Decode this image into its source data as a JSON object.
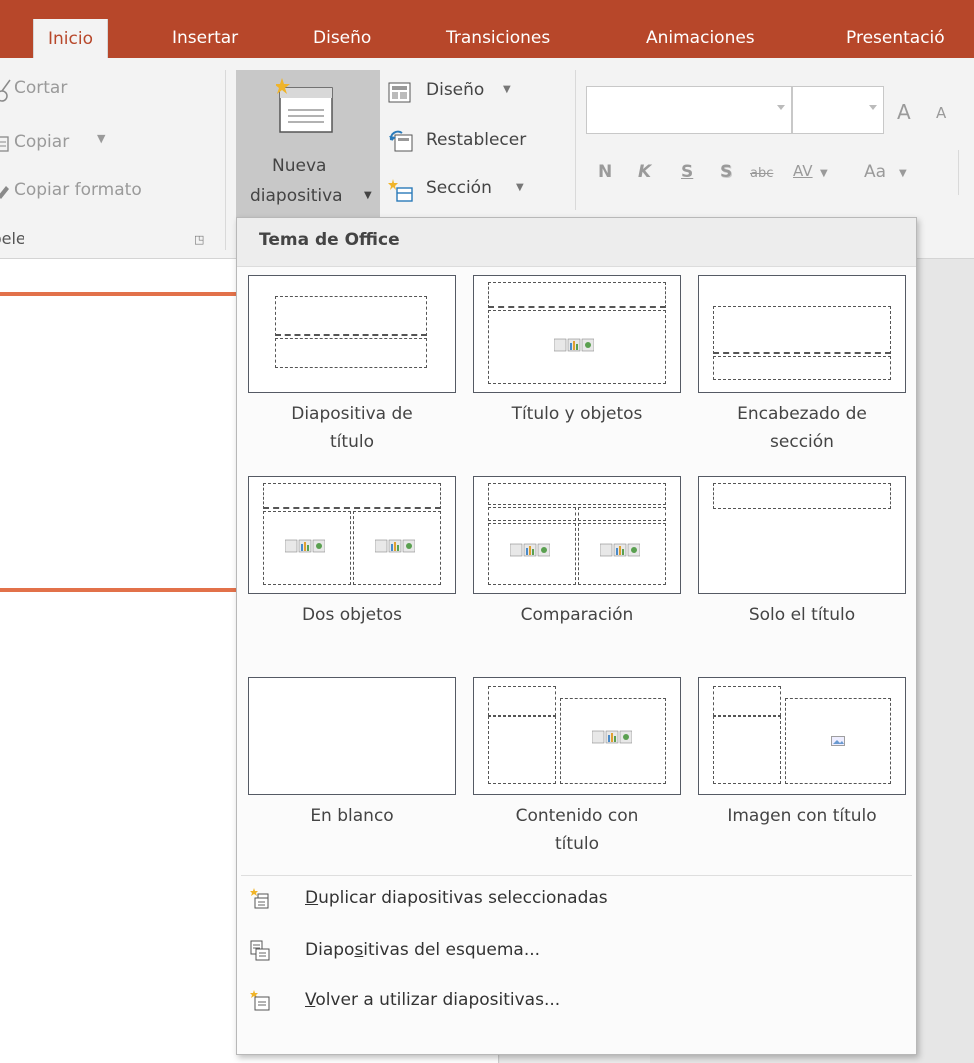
{
  "tabs": [
    {
      "label": "Inicio",
      "active": true
    },
    {
      "label": "Insertar"
    },
    {
      "label": "Diseño"
    },
    {
      "label": "Transiciones"
    },
    {
      "label": "Animaciones"
    },
    {
      "label": "Presentació"
    }
  ],
  "clipboard": {
    "cut": "Cortar",
    "copy": "Copiar",
    "format_painter": "Copiar formato",
    "group_label": "Portapapeles"
  },
  "slides_group": {
    "new_slide_line1": "Nueva",
    "new_slide_line2": "diapositiva",
    "layout": "Diseño",
    "reset": "Restablecer",
    "section": "Sección"
  },
  "font_group": {
    "grow": "A",
    "shrink": "A",
    "bold": "N",
    "italic": "K",
    "underline": "S",
    "shadow": "S",
    "strike": "abc",
    "spacing": "AV",
    "case": "Aa"
  },
  "dropdown": {
    "header": "Tema de Office",
    "layouts": [
      {
        "line1": "Diapositiva de",
        "line2": "título"
      },
      {
        "line1": "Título y objetos",
        "line2": ""
      },
      {
        "line1": "Encabezado de",
        "line2": "sección"
      },
      {
        "line1": "Dos objetos",
        "line2": ""
      },
      {
        "line1": "Comparación",
        "line2": ""
      },
      {
        "line1": "Solo el título",
        "line2": ""
      },
      {
        "line1": "En blanco",
        "line2": ""
      },
      {
        "line1": "Contenido con",
        "line2": "título"
      },
      {
        "line1": "Imagen con título",
        "line2": ""
      }
    ],
    "menu": [
      {
        "underlined": "D",
        "rest": "uplicar diapositivas seleccionadas",
        "icon": "duplicate-slides-icon"
      },
      {
        "prefix": "Diapo",
        "underlined": "s",
        "rest": "itivas del esquema...",
        "icon": "outline-slides-icon"
      },
      {
        "underlined": "V",
        "rest": "olver a utilizar diapositivas...",
        "icon": "reuse-slides-icon"
      }
    ]
  },
  "colors": {
    "accent": "#b7472a",
    "ribbon": "#f3f3f3",
    "orange_line": "#e2714a"
  }
}
